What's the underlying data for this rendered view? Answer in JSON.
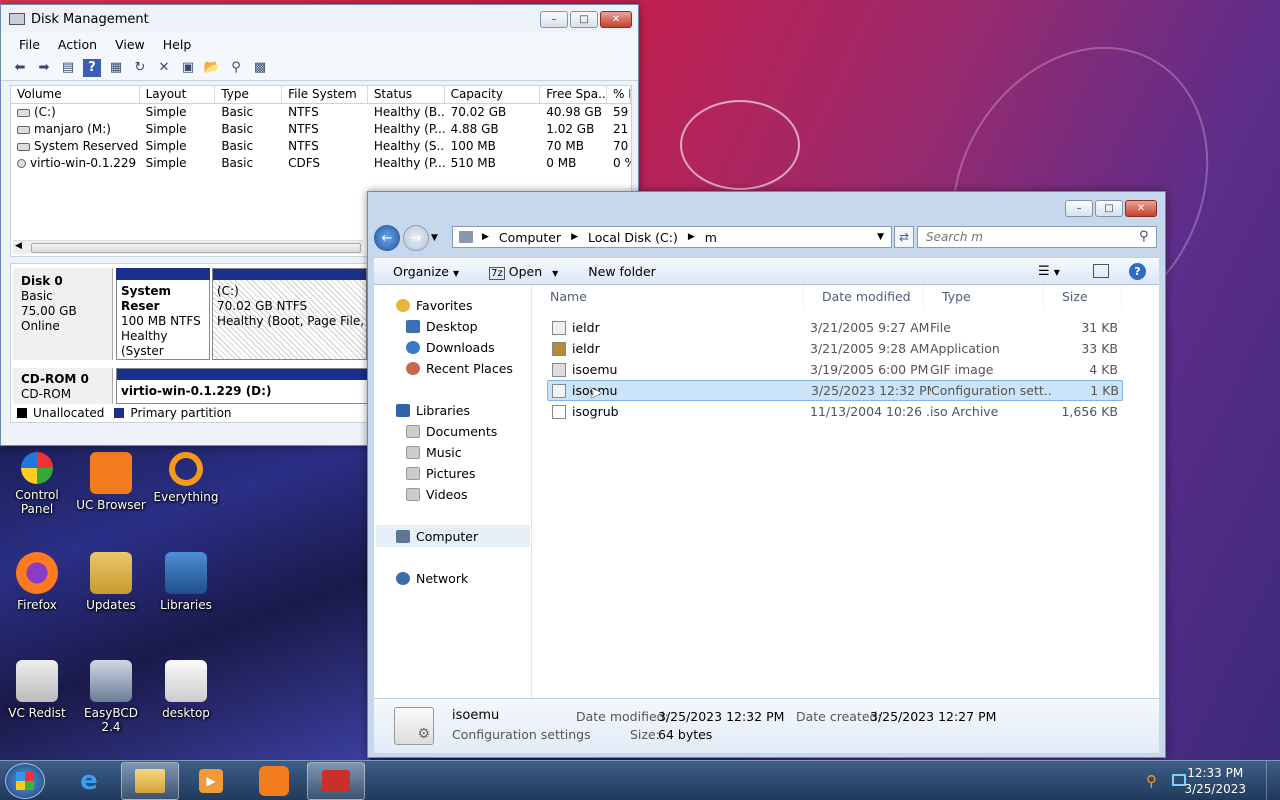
{
  "disk_mgmt": {
    "title": "Disk Management",
    "menu": [
      "File",
      "Action",
      "View",
      "Help"
    ],
    "columns": [
      "Volume",
      "Layout",
      "Type",
      "File System",
      "Status",
      "Capacity",
      "Free Spa...",
      "% F"
    ],
    "rows": [
      [
        "(C:)",
        "Simple",
        "Basic",
        "NTFS",
        "Healthy (B...",
        "70.02 GB",
        "40.98 GB",
        "59"
      ],
      [
        "manjaro (M:)",
        "Simple",
        "Basic",
        "NTFS",
        "Healthy (P...",
        "4.88 GB",
        "1.02 GB",
        "21"
      ],
      [
        "System Reserved",
        "Simple",
        "Basic",
        "NTFS",
        "Healthy (S...",
        "100 MB",
        "70 MB",
        "70"
      ],
      [
        "virtio-win-0.1.229 ...",
        "Simple",
        "Basic",
        "CDFS",
        "Healthy (P...",
        "510 MB",
        "0 MB",
        "0 %"
      ]
    ],
    "disk0": {
      "name": "Disk 0",
      "type": "Basic",
      "size": "75.00 GB",
      "state": "Online"
    },
    "part_sysres": {
      "name": "System Reser",
      "size": "100 MB NTFS",
      "status": "Healthy (Syster"
    },
    "part_c": {
      "name": "(C:)",
      "size": "70.02 GB NTFS",
      "status": "Healthy (Boot, Page File, Cra"
    },
    "cdrom": {
      "name": "CD-ROM 0",
      "type": "CD-ROM",
      "part": "virtio-win-0.1.229 (D:)"
    },
    "legend": {
      "unallocated": "Unallocated",
      "primary": "Primary partition"
    }
  },
  "explorer": {
    "breadcrumb": [
      "Computer",
      "Local Disk (C:)",
      "m"
    ],
    "search_placeholder": "Search m",
    "cmd": {
      "organize": "Organize",
      "open": "Open",
      "new_folder": "New folder"
    },
    "nav": {
      "favorites": "Favorites",
      "desktop": "Desktop",
      "downloads": "Downloads",
      "recent": "Recent Places",
      "libraries": "Libraries",
      "documents": "Documents",
      "music": "Music",
      "pictures": "Pictures",
      "videos": "Videos",
      "computer": "Computer",
      "network": "Network"
    },
    "columns": {
      "name": "Name",
      "date": "Date modified",
      "type": "Type",
      "size": "Size"
    },
    "files": [
      {
        "name": "ieldr",
        "date": "3/21/2005 9:27 AM",
        "type": "File",
        "size": "31 KB"
      },
      {
        "name": "ieldr",
        "date": "3/21/2005 9:28 AM",
        "type": "Application",
        "size": "33 KB"
      },
      {
        "name": "isoemu",
        "date": "3/19/2005 6:00 PM",
        "type": "GIF image",
        "size": "4 KB"
      },
      {
        "name": "isoemu",
        "date": "3/25/2023 12:32 PM",
        "type": "Configuration sett...",
        "size": "1 KB"
      },
      {
        "name": "isogrub",
        "date": "11/13/2004 10:26 ...",
        "type": "iso Archive",
        "size": "1,656 KB"
      }
    ],
    "details": {
      "name": "isoemu",
      "kind": "Configuration settings",
      "modified_label": "Date modified:",
      "modified": "3/25/2023 12:32 PM",
      "created_label": "Date created:",
      "created": "3/25/2023 12:27 PM",
      "size_label": "Size:",
      "size": "64 bytes"
    }
  },
  "desktop_icons": [
    {
      "label": "Control Panel"
    },
    {
      "label": "UC Browser"
    },
    {
      "label": "Everything"
    },
    {
      "label": "Firefox"
    },
    {
      "label": "Updates"
    },
    {
      "label": "Libraries"
    },
    {
      "label": "VC Redist"
    },
    {
      "label": "EasyBCD 2.4"
    },
    {
      "label": "desktop"
    }
  ],
  "taskbar": {
    "time": "12:33 PM",
    "date": "3/25/2023"
  }
}
